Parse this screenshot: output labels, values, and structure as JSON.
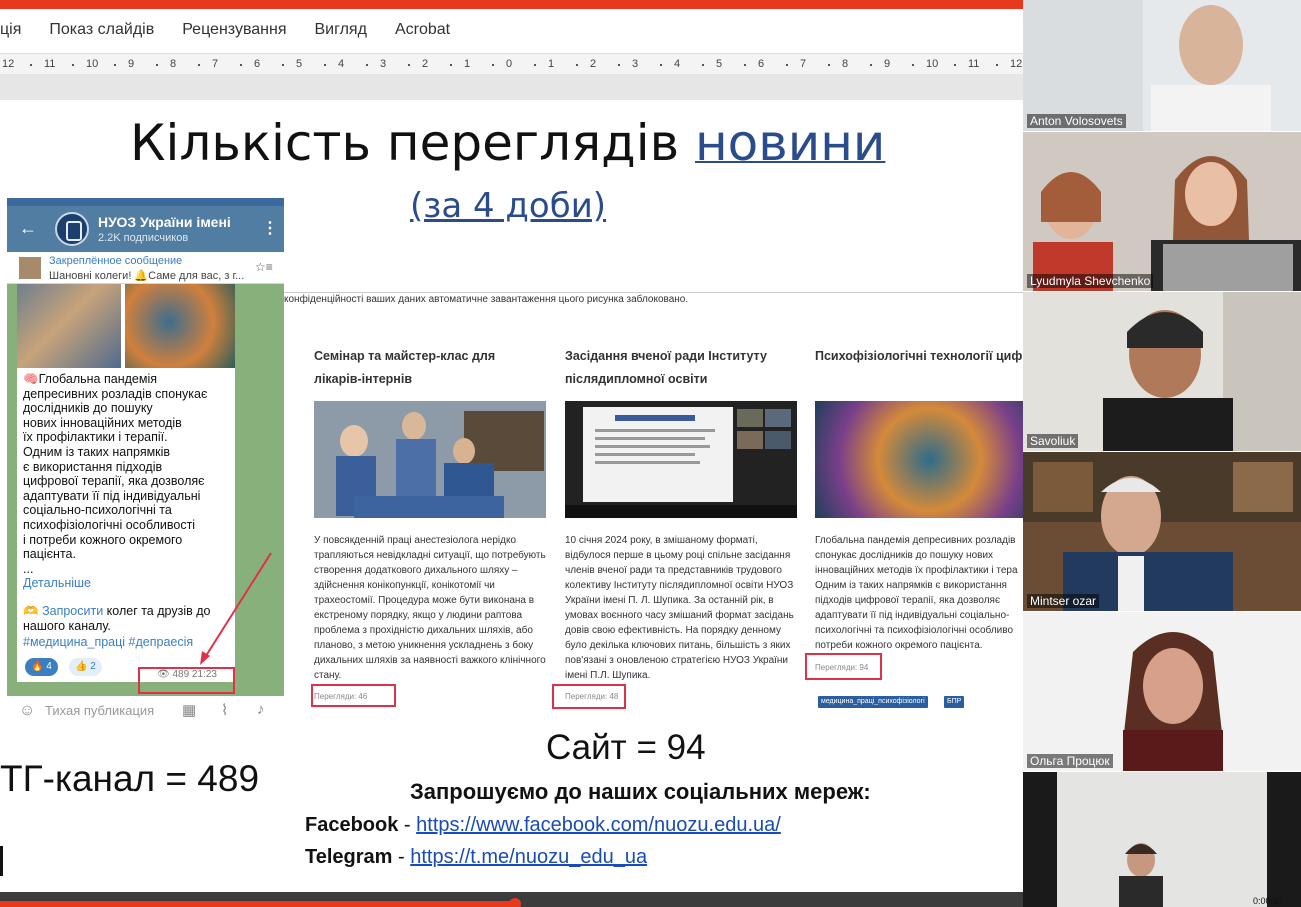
{
  "ribbon": {
    "tabs": [
      "ція",
      "Показ слайдів",
      "Рецензування",
      "Вигляд",
      "Acrobat"
    ]
  },
  "ruler": {
    "ticks": [
      "12",
      "11",
      "10",
      "9",
      "8",
      "7",
      "6",
      "5",
      "4",
      "3",
      "2",
      "1",
      "0",
      "1",
      "2",
      "3",
      "4",
      "5",
      "6",
      "7",
      "8",
      "9",
      "10",
      "11",
      "12"
    ]
  },
  "slide": {
    "title_plain": "Кількість переглядів",
    "title_link": "новини",
    "subtitle": "(за 4 доби)",
    "telegram": {
      "channel_name": "НУОЗ України імені",
      "subscribers": "2.2K подписчиков",
      "pinned_title": "Закреплённое сообщение",
      "pinned_text": "Шановні колеги! 🔔Саме для вас, з г...",
      "post_text": "🧠Глобальна пандемія\nдепресивних розладів спонукає\nдослідників до пошуку\nнових інноваційних методів\nїх профілактики і терапії.\nОдним із таких напрямків\nє використання підходів\nцифрової терапії, яка дозволяє\nадаптувати її під індивідуальні\nсоціально-психологічні та\nпсихофізіологічні особливості\nі потреби кожного окремого\nпацієнта.\n...",
      "more_link": "Детальніше",
      "invite_emoji": "🫶",
      "invite_link": "Запросити",
      "invite_rest": " колег та друзів до нашого каналу.",
      "hashtags": "#медицина_праці #депраесія",
      "reaction1": "🔥 4",
      "reaction2": "👍 2",
      "views": "👁 489  21:23",
      "input_placeholder": "Тихая публикация"
    },
    "tg_count": "ТГ-канал = 489",
    "blocked_notice": "конфіденційності ваших даних автоматичне завантаження цього рисунка заблоковано.",
    "cards": [
      {
        "title": "Семінар та майстер-клас для лікарів-інтернів",
        "desc": "У повсякденній праці анестезіолога нерідко трапляються невідкладні ситуації, що потребують створення додаткового дихального шляху – здійснення конікопункції, конікотомії чи трахеостомії. Процедура може бути виконана в екстреному порядку, якщо у людини раптова проблема з прохідністю дихальних шляхів, або планово, з метою уникнення ускладнень з боку дихальних шляхів за наявності важкого клінічного стану.",
        "views": "Перегляди: 46"
      },
      {
        "title": "Засідання вченої ради Інституту післядипломної освіти",
        "desc": "10 січня 2024 року, в змішаному форматі, відбулося перше в цьому році спільне засідання членів вченої ради та представників трудового колективу Інституту післядипломної освіти НУОЗ України імені П. Л. Шупика. За останній рік, в умовах воєнного часу змішаний формат засідань довів свою ефективність. На порядку денному було декілька ключових питань, більшість з яких пов'язані з оновленою стратегією НУОЗ України імені П.Л. Шупика.",
        "views": "Перегляди: 48"
      },
      {
        "title": "Психофізіологічні технології цифрової терапії депресивних ста",
        "desc": "Глобальна пандемія депресивних розладів спонукає дослідників до пошуку нових інноваційних методів їх профілактики і тера Одним із таких напрямків є використання підходів цифрової терапії, яка дозволяє адаптувати її під індивідуальні соціально-психологічні та психофізіологічні особливо потреби кожного окремого пацієнта.",
        "views": "Перегляди: 94",
        "tags": [
          "медицина_праці_психофізіологі",
          "БПР"
        ]
      }
    ],
    "site_count": "Сайт = 94",
    "invite_heading": "Запрошуємо до наших соціальних мереж:",
    "facebook_label": "Facebook",
    "facebook_url": "https://www.facebook.com/nuozu.edu.ua/",
    "telegram_label": "Telegram",
    "telegram_url": "https://t.me/nuozu_edu_ua",
    "separator": " - "
  },
  "participants": [
    {
      "name": "Anton Volosovets"
    },
    {
      "name": "Lyudmyla Shevchenko"
    },
    {
      "name": "Savoliuk"
    },
    {
      "name": "Mintser ozar"
    },
    {
      "name": "Ольга Процюк"
    },
    {
      "name": ""
    }
  ],
  "colors": {
    "accent_red": "#e8391f",
    "link_blue": "#2b4c8c",
    "telegram_blue": "#517da2",
    "highlight_box": "#e0314a"
  }
}
